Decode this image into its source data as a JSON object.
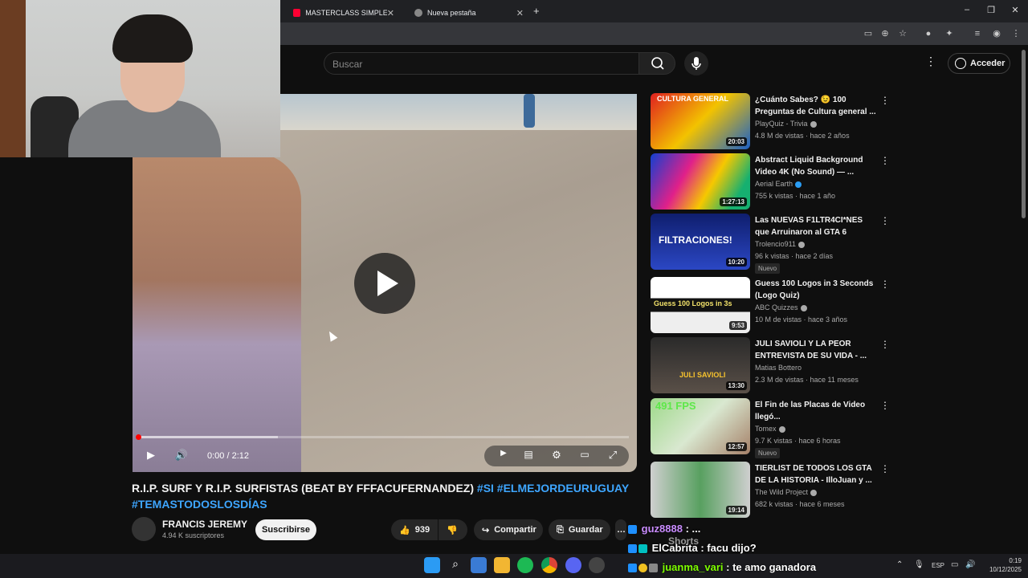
{
  "browser": {
    "tabs": [
      {
        "label": "MASTERCLASS SIMPLE (videocl",
        "favicon": "youtube-icon"
      },
      {
        "label": "Nueva pestaña",
        "favicon": "chrome-icon"
      }
    ],
    "new_tab": "+"
  },
  "header": {
    "search_placeholder": "Buscar",
    "signin_label": "Acceder"
  },
  "player": {
    "time": "0:00 / 2:12",
    "progress": 0.0
  },
  "video": {
    "title_main": "R.I.P. SURF Y R.I.P. SURFISTAS (BEAT BY FFFACUFERNANDEZ)",
    "hashtags_line1": "#SI #ELMEJORDEURUGUAY",
    "hashtags_line2": "#TEMASTODOSLOSDÍAS",
    "channel": "FRANCIS JEREMY",
    "subscribers": "4.94 K suscriptores",
    "subscribe_label": "Suscribirse",
    "likes": "939",
    "share_label": "Compartir",
    "save_label": "Guardar"
  },
  "recommendations": [
    {
      "title": "¿Cuánto Sabes? 😉 100 Preguntas de Cultura general ...",
      "channel": "PlayQuiz - Trivia",
      "meta": "4.8 M de vistas · hace 2 años",
      "duration": "20:03",
      "badge": "",
      "thumb_text": "CULTURA GENERAL"
    },
    {
      "title": "Abstract Liquid Background Video 4K (No Sound) — ...",
      "channel": "Aerial Earth",
      "meta": "755 k vistas · hace 1 año",
      "duration": "1:27:13",
      "badge": "",
      "thumb_text": ""
    },
    {
      "title": "Las NUEVAS F1LTR4CI*NES que Arruinaron al GTA 6",
      "channel": "Trolencio911",
      "meta": "96 k vistas · hace 2 días",
      "duration": "10:20",
      "badge": "Nuevo",
      "thumb_text": "FILTRACIONES!"
    },
    {
      "title": "Guess 100 Logos in 3 Seconds (Logo Quiz)",
      "channel": "ABC Quizzes",
      "meta": "10 M de vistas · hace 3 años",
      "duration": "9:53",
      "badge": "",
      "thumb_text": "Guess 100 Logos in 3s"
    },
    {
      "title": "JULI SAVIOLI Y LA PEOR ENTREVISTA DE SU VIDA - ...",
      "channel": "Matias Bottero",
      "meta": "2.3 M de vistas · hace 11 meses",
      "duration": "13:30",
      "badge": "",
      "thumb_text": "JULI SAVIOLI"
    },
    {
      "title": "El Fin de las Placas de Video llegó...",
      "channel": "Tomex",
      "meta": "9.7 K vistas · hace 6 horas",
      "duration": "12:57",
      "badge": "Nuevo",
      "thumb_text": "491 FPS"
    },
    {
      "title": "TIERLIST DE TODOS LOS GTA DE LA HISTORIA - IlloJuan y ...",
      "channel": "The Wild Project",
      "meta": "682 k vistas · hace 6 meses",
      "duration": "19:14",
      "badge": "",
      "thumb_text": ""
    }
  ],
  "shorts_label": "Shorts",
  "chat": [
    {
      "user": "guz8888",
      "text": ": ..."
    },
    {
      "user": "ElCabrita",
      "text": ": facu dijo?"
    },
    {
      "user": "juanma_vari",
      "text": ": te amo ganadora"
    }
  ],
  "taskbar": {
    "lang": "ESP",
    "time": "0:19",
    "date": "10/12/2025"
  },
  "colors": {
    "accent": "#3ea6ff",
    "progress": "#ff0000",
    "chat_user": "#7fff00"
  }
}
